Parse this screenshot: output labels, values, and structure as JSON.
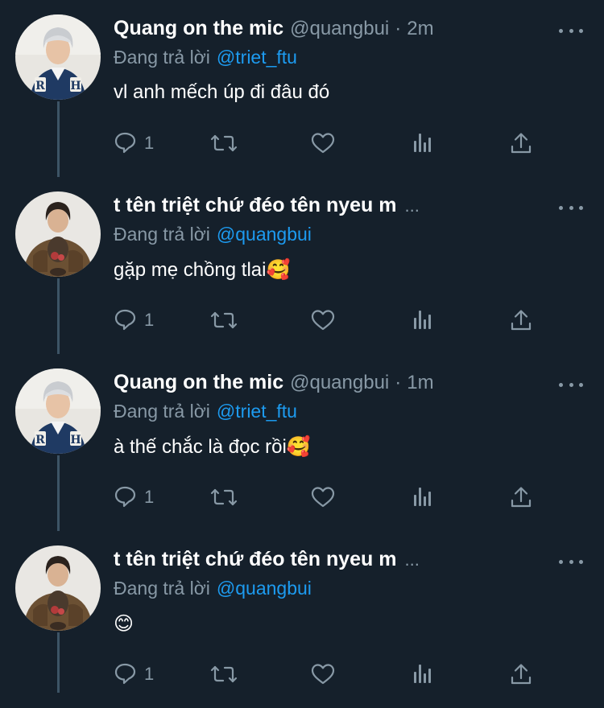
{
  "colors": {
    "background": "#15202b",
    "text_primary": "#ffffff",
    "text_secondary": "#8899a6",
    "link": "#1d9bf0",
    "thread_line": "#3d5466"
  },
  "tweets": [
    {
      "author_name": "Quang on the mic",
      "handle": "@quangbui",
      "separator": "·",
      "time": "2m",
      "reply_prefix": "Đang trả lời",
      "reply_to": "@triet_ftu",
      "text": "vl anh mếch úp đi đâu đó",
      "reply_count": "1",
      "avatar": "rh-jacket-avatar"
    },
    {
      "author_name": "t tên triệt chứ đéo tên nyeu m",
      "name_truncation": "...",
      "reply_prefix": "Đang trả lời",
      "reply_to": "@quangbui",
      "text": "gặp mẹ chồng tlai",
      "emoji": "🥰",
      "reply_count": "1",
      "avatar": "brown-jacket-avatar"
    },
    {
      "author_name": "Quang on the mic",
      "handle": "@quangbui",
      "separator": "·",
      "time": "1m",
      "reply_prefix": "Đang trả lời",
      "reply_to": "@triet_ftu",
      "text": "à thế chắc là đọc rồi",
      "emoji": "🥰",
      "reply_count": "1",
      "avatar": "rh-jacket-avatar"
    },
    {
      "author_name": "t tên triệt chứ đéo tên nyeu m",
      "name_truncation": "...",
      "reply_prefix": "Đang trả lời",
      "reply_to": "@quangbui",
      "text": "",
      "emoji": "😊",
      "reply_count": "1",
      "avatar": "brown-jacket-avatar"
    }
  ],
  "icons": [
    "reply-icon",
    "retweet-icon",
    "like-icon",
    "analytics-icon",
    "share-icon",
    "more-options-icon"
  ]
}
